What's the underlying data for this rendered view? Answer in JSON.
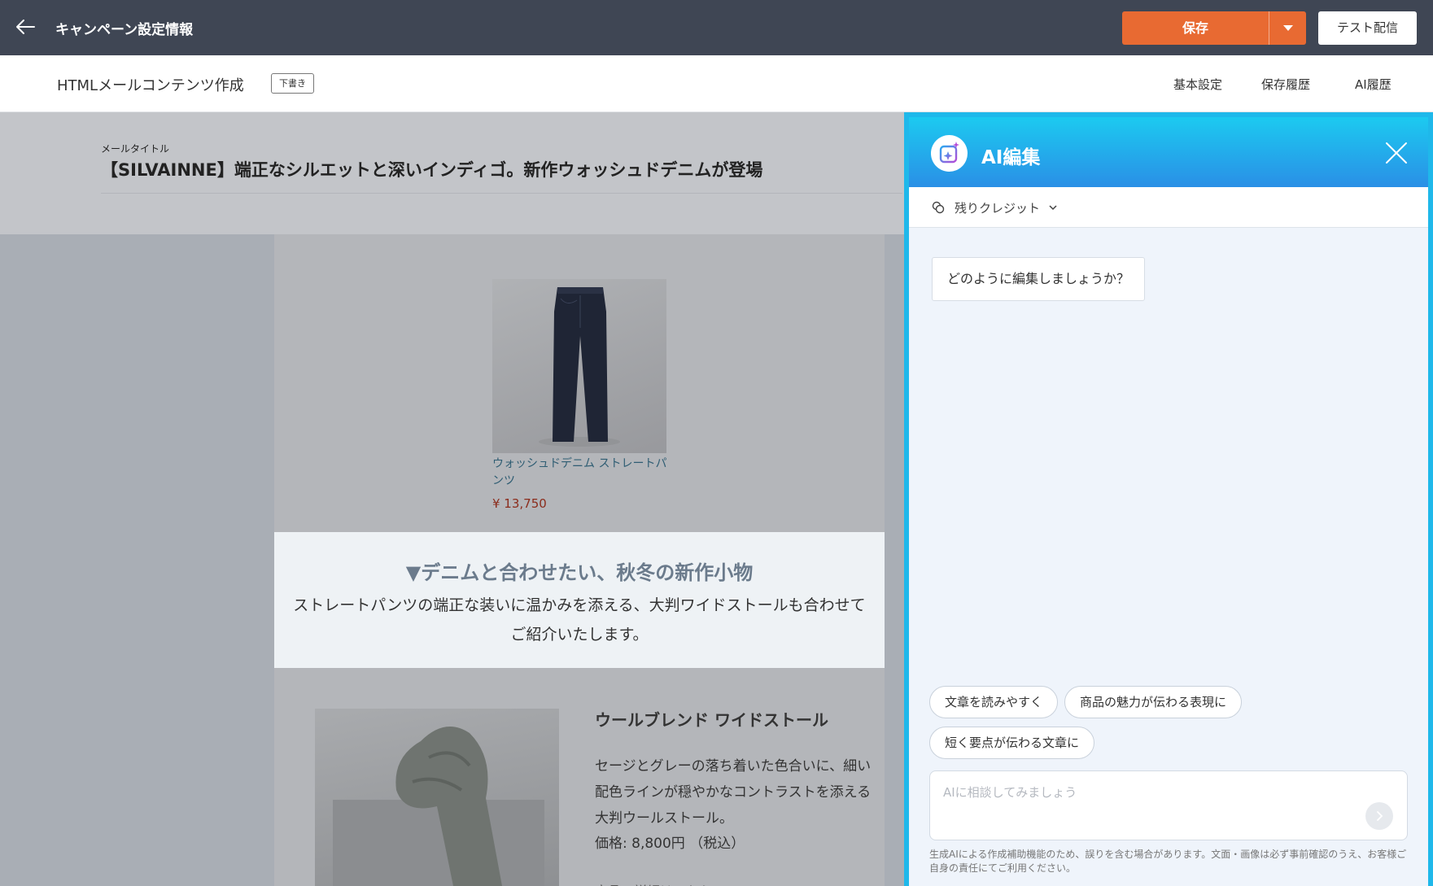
{
  "header": {
    "title": "キャンペーン設定情報",
    "save_label": "保存",
    "test_label": "テスト配信"
  },
  "subheader": {
    "title": "HTMLメールコンテンツ作成",
    "badge": "下書き",
    "links": [
      "基本設定",
      "保存履歴",
      "AI履歴"
    ]
  },
  "mail": {
    "title_label": "メールタイトル",
    "title": "【SILVAINNE】端正なシルエットと深いインディゴ。新作ウォッシュドデニムが登場",
    "product1": {
      "name": "ウォッシュドデニム ストレートパンツ",
      "price": "¥ 13,750"
    },
    "section": {
      "heading": "▼デニムと合わせたい、秋冬の新作小物",
      "text": "ストレートパンツの端正な装いに温かみを添える、大判ワイドストールも合わせてご紹介いたします。"
    },
    "product2": {
      "name": "ウールブレンド ワイドストール",
      "description": "セージとグレーの落ち着いた色合いに、細い配色ラインが穏やかなコントラストを添える大判ウールストール。",
      "price": "価格: 8,800円 （税込）",
      "more": "商品の詳細はこちら"
    }
  },
  "ai_panel": {
    "title": "AI編集",
    "credit_label": "残りクレジット",
    "bubble": "どのように編集しましょうか？",
    "chips": [
      "文章を読みやすく",
      "商品の魅力が伝わる表現に",
      "短く要点が伝わる文章に"
    ],
    "input_placeholder": "AIに相談してみましょう",
    "disclaimer": "生成AIによる作成補助機能のため、誤りを含む場合があります。文面・画像は必ず事前確認のうえ、お客様ご自身の責任にてご利用ください。"
  },
  "colors": {
    "topbar": "#3f4654",
    "save": "#e86a32",
    "ai_accent": "#1fb8ea",
    "price": "#8b2c1c"
  }
}
